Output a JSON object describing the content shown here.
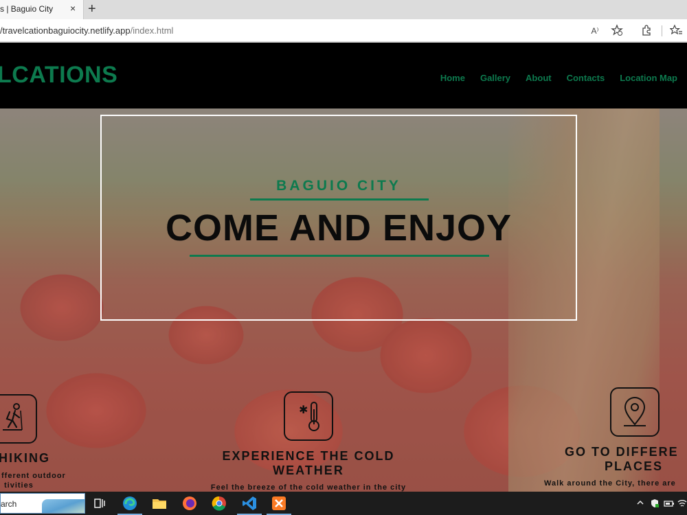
{
  "browser": {
    "tab_title": "s | Baguio City",
    "tab_close": "×",
    "new_tab": "+",
    "url_host": "/travelcationbaguiocity.netlify.app",
    "url_path": "/index.html",
    "icons": [
      "read-aloud-icon",
      "favorite-add-icon",
      "extensions-icon",
      "favorites-icon"
    ],
    "read_aloud_glyph": "A⁾"
  },
  "site": {
    "logo": "LCATIONS",
    "nav": [
      "Home",
      "Gallery",
      "About",
      "Contacts",
      "Location Map"
    ],
    "hero": {
      "subtitle": "BAGUIO CITY",
      "title": "COME AND ENJOY"
    },
    "features": [
      {
        "icon": "hiker-icon",
        "title": "HIKING",
        "desc_lines": [
          "fferent outdoor",
          "tivities"
        ]
      },
      {
        "icon": "thermometer-cold-icon",
        "title_lines": [
          "EXPERIENCE THE COLD",
          "WEATHER"
        ],
        "desc_lines": [
          "Feel the breeze of the cold weather in the city"
        ]
      },
      {
        "icon": "location-pin-icon",
        "title_lines": [
          "GO TO DIFFERE",
          "PLACES"
        ],
        "desc_lines": [
          "Walk around the City, there are"
        ]
      }
    ]
  },
  "taskbar": {
    "search_text": "arch",
    "apps": [
      "task-view-icon",
      "edge-icon",
      "file-explorer-icon",
      "firefox-icon",
      "chrome-icon",
      "vscode-icon",
      "xampp-icon"
    ],
    "tray": [
      "chevron-up-icon",
      "defender-icon",
      "battery-icon",
      "wifi-icon"
    ]
  },
  "colors": {
    "accent": "#0d7a4e",
    "header_bg": "#000000"
  }
}
